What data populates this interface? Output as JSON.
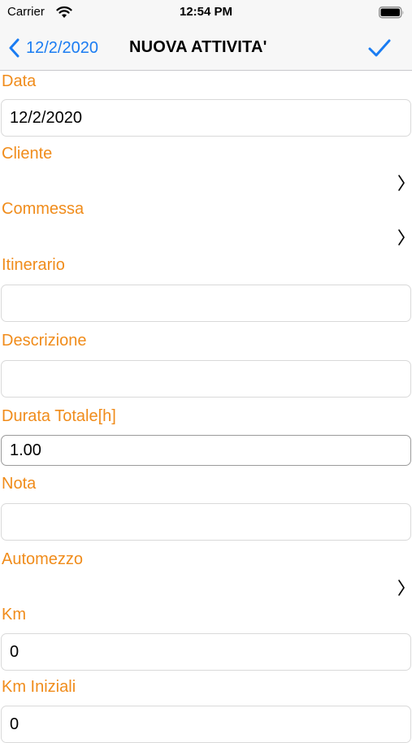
{
  "status_bar": {
    "carrier": "Carrier",
    "time": "12:54 PM"
  },
  "nav": {
    "back_label": "12/2/2020",
    "title": "NUOVA ATTIVITA'",
    "accent_color": "#1a7cf2"
  },
  "form": {
    "label_color": "#f08c1b",
    "data": {
      "label": "Data",
      "value": "12/2/2020"
    },
    "cliente": {
      "label": "Cliente"
    },
    "commessa": {
      "label": "Commessa"
    },
    "itinerario": {
      "label": "Itinerario",
      "value": ""
    },
    "descrizione": {
      "label": "Descrizione",
      "value": ""
    },
    "durata": {
      "label": "Durata Totale[h]",
      "value": "1.00"
    },
    "nota": {
      "label": "Nota",
      "value": ""
    },
    "automezzo": {
      "label": "Automezzo"
    },
    "km": {
      "label": "Km",
      "value": "0"
    },
    "km_iniziali": {
      "label": "Km Iniziali",
      "value": "0"
    }
  }
}
